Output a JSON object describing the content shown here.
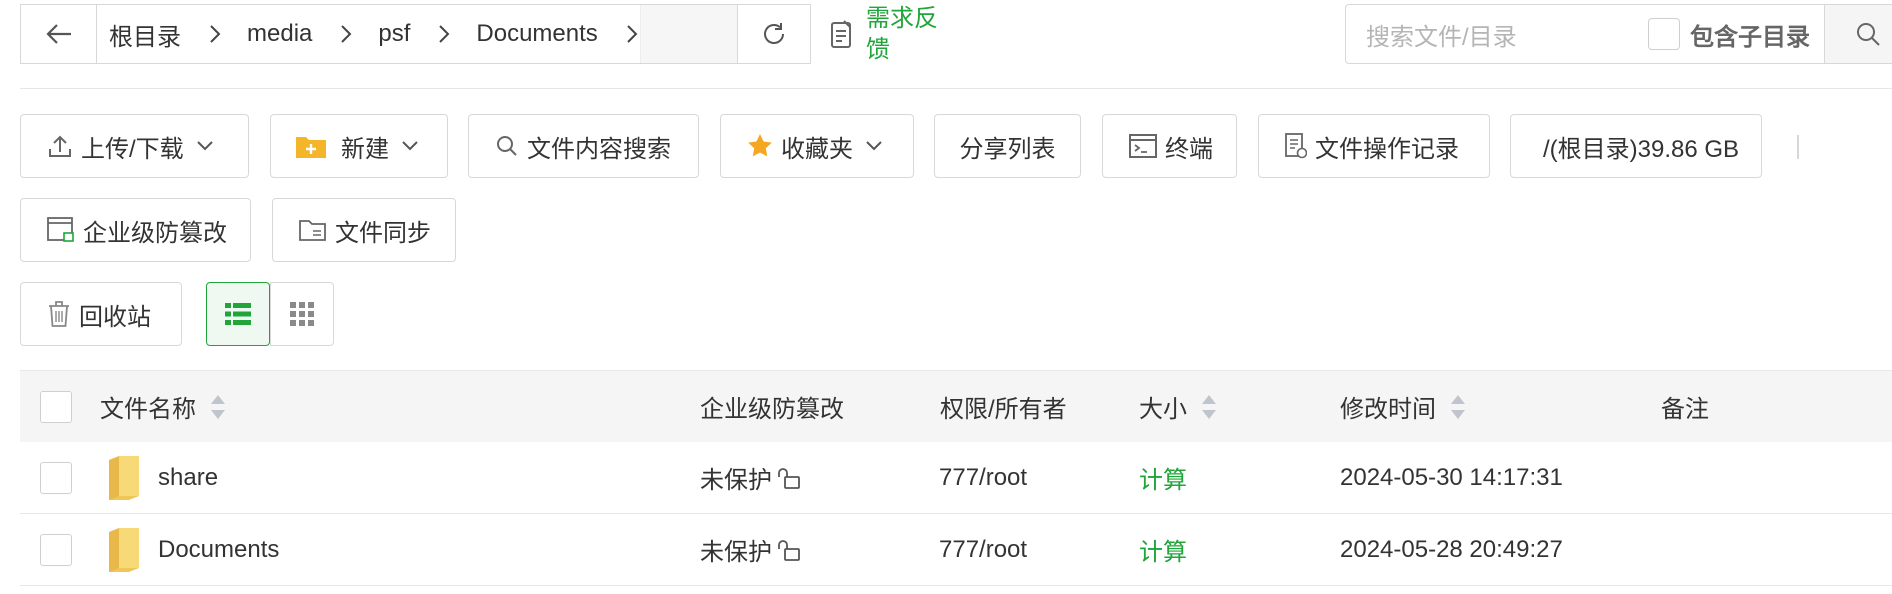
{
  "breadcrumb": {
    "items": [
      "根目录",
      "media",
      "psf",
      "Documents"
    ]
  },
  "feedback": {
    "label": "需求反馈"
  },
  "search": {
    "placeholder": "搜索文件/目录",
    "include_subdir_label": "包含子目录"
  },
  "toolbar": {
    "upload_download": "上传/下载",
    "new": "新建",
    "content_search": "文件内容搜索",
    "favorites": "收藏夹",
    "share_list": "分享列表",
    "terminal": "终端",
    "op_log": "文件操作记录",
    "disk": "/(根目录)39.86 GB",
    "tamper_proof": "企业级防篡改",
    "file_sync": "文件同步",
    "recycle_bin": "回收站"
  },
  "table": {
    "headers": {
      "name": "文件名称",
      "tamper": "企业级防篡改",
      "perm": "权限/所有者",
      "size": "大小",
      "mtime": "修改时间",
      "note": "备注"
    },
    "rows": [
      {
        "name": "share",
        "tamper": "未保护",
        "perm": "777/root",
        "size": "计算",
        "mtime": "2024-05-30 14:17:31"
      },
      {
        "name": "Documents",
        "tamper": "未保护",
        "perm": "777/root",
        "size": "计算",
        "mtime": "2024-05-28 20:49:27"
      }
    ]
  },
  "colors": {
    "accent": "#20a53a",
    "border": "#d8d8d8",
    "folder": "#f5d36a"
  }
}
